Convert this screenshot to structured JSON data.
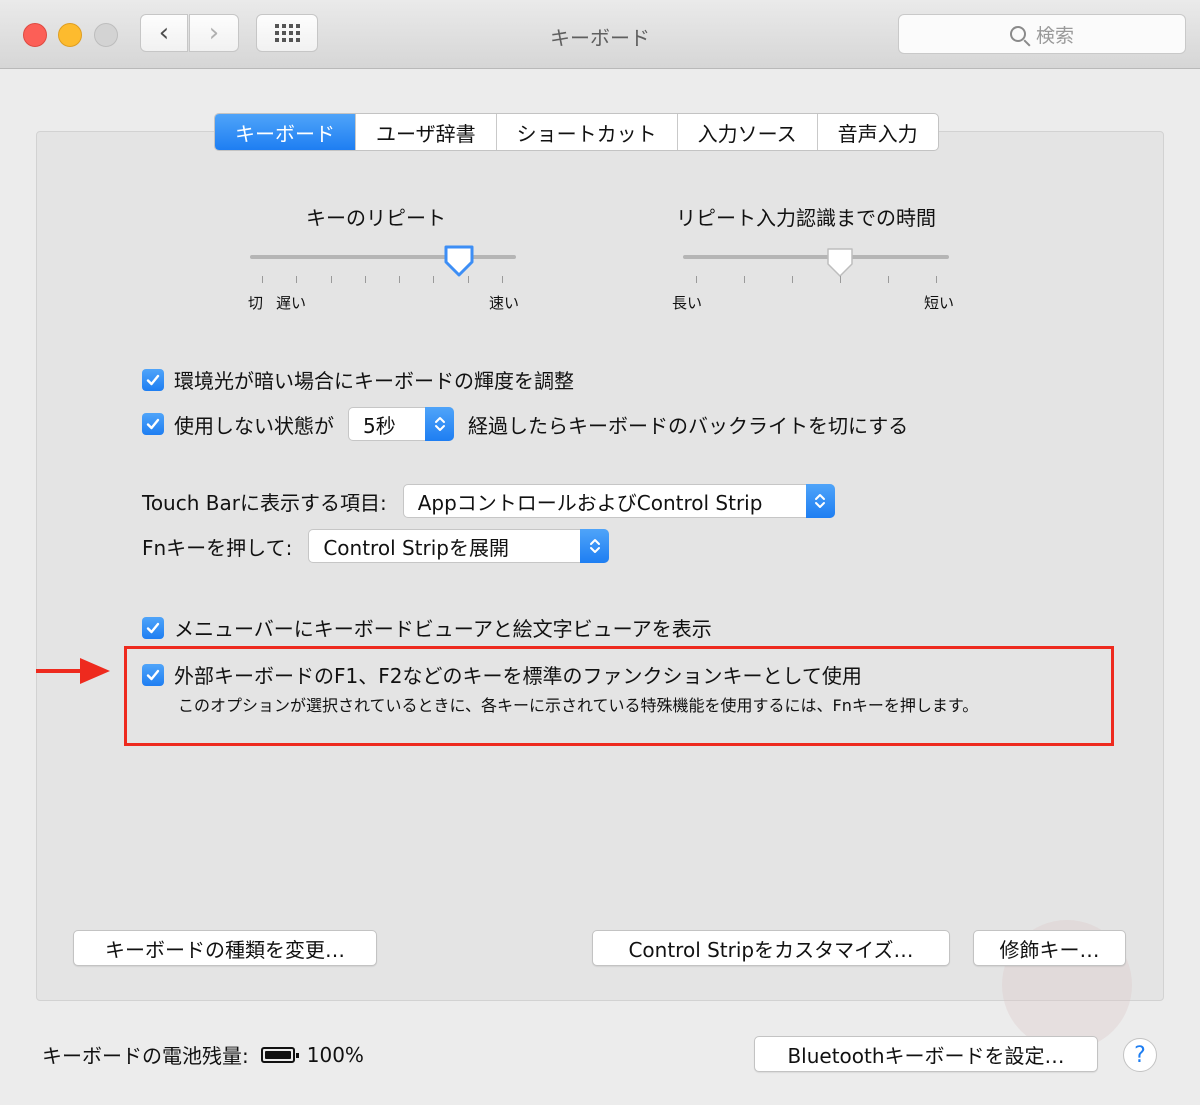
{
  "window": {
    "title": "キーボード",
    "search_placeholder": "検索"
  },
  "tabs": [
    {
      "label": "キーボード",
      "active": true
    },
    {
      "label": "ユーザ辞書",
      "active": false
    },
    {
      "label": "ショートカット",
      "active": false
    },
    {
      "label": "入力ソース",
      "active": false
    },
    {
      "label": "音声入力",
      "active": false
    }
  ],
  "key_repeat": {
    "title": "キーのリピート",
    "label_off": "切",
    "label_slow": "遅い",
    "label_fast": "速い",
    "value_fraction": 0.82
  },
  "delay_until_repeat": {
    "title": "リピート入力認識までの時間",
    "label_long": "長い",
    "label_short": "短い",
    "value_fraction": 0.6
  },
  "options": {
    "adjust_brightness": {
      "label": "環境光が暗い場合にキーボードの輝度を調整",
      "checked": true
    },
    "backlight_off": {
      "label_before": "使用しない状態が",
      "value": "5秒",
      "label_after": "経過したらキーボードのバックライトを切にする",
      "checked": true
    }
  },
  "touch_bar": {
    "label": "Touch Barに表示する項目:",
    "value": "AppコントロールおよびControl Strip"
  },
  "fn_key": {
    "label": "Fnキーを押して:",
    "value": "Control Stripを展開"
  },
  "viewer_option": {
    "label": "メニューバーにキーボードビューアと絵文字ビューアを表示",
    "checked": true
  },
  "function_keys_option": {
    "label": "外部キーボードのF1、F2などのキーを標準のファンクションキーとして使用",
    "description": "このオプションが選択されているときに、各キーに示されている特殊機能を使用するには、Fnキーを押します。",
    "checked": true
  },
  "buttons": {
    "change_type": "キーボードの種類を変更…",
    "customize_strip": "Control Stripをカスタマイズ…",
    "modifier_keys": "修飾キー…",
    "bluetooth_setup": "Bluetoothキーボードを設定…",
    "help": "?"
  },
  "battery": {
    "label": "キーボードの電池残量:",
    "value": "100%"
  },
  "colors": {
    "accent": "#1e7ef2",
    "highlight": "#ee2a1e"
  }
}
